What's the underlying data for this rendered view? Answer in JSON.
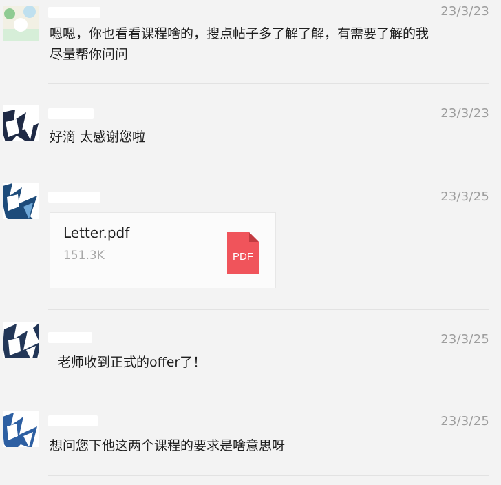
{
  "messages": [
    {
      "date": "23/3/23",
      "text": "嗯嗯，你也看看课程啥的，搜点帖子多了解了解，有需要了解的我尽量帮你问问"
    },
    {
      "date": "23/3/23",
      "text": "好滴 太感谢您啦"
    },
    {
      "date": "23/3/25",
      "file": {
        "name": "Letter.pdf",
        "size": "151.3K",
        "type_label": "PDF"
      }
    },
    {
      "date": "23/3/25",
      "text": "老师收到正式的offer了！"
    },
    {
      "date": "23/3/25",
      "text": "想问您下他这两个课程的要求是啥意思呀"
    }
  ],
  "colors": {
    "background": "#f3f3f3",
    "date_text": "#9d9d9d",
    "pdf_icon": "#f0545b",
    "divider": "#e2e2e2"
  },
  "icons": {
    "pdf": "pdf-file-icon"
  }
}
